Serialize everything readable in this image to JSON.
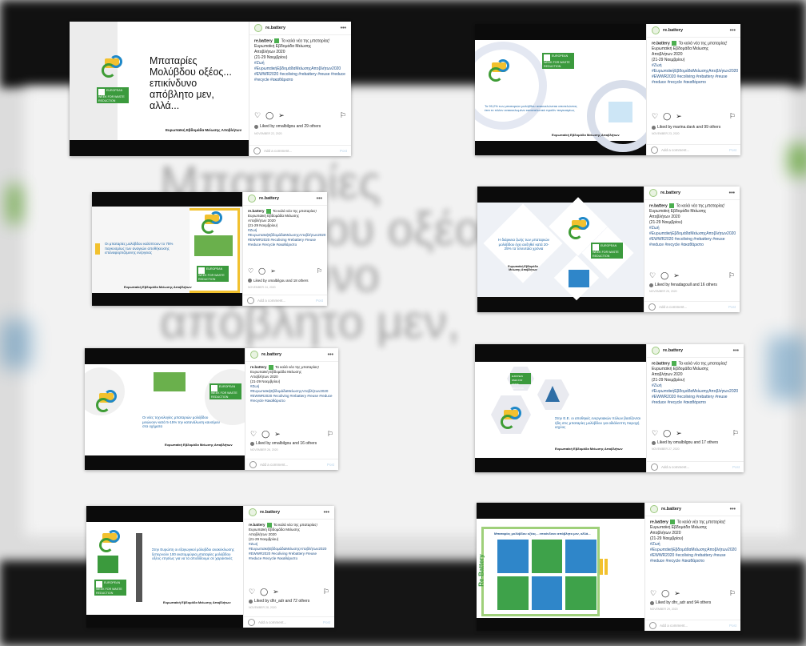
{
  "account": "re.battery",
  "more": "•••",
  "caption": {
    "line1": "Τα καλά νέα της",
    "line2": "μπαταρίας!",
    "line3": "Ευρωπαϊκή Εβδομάδα Μείωσης",
    "line4": "Αποβλήτων 2020",
    "line5": "(21-29 Νοεμβρίου)",
    "tags": "#Ζωή #ΕυρωπαϊκήΕβδομάδαΜείωσηςΑποβλήτων2020 #EWWR2020 #ecoliving #rebattery #reuse #reduce #recycle #ακαθάριστο"
  },
  "comment_placeholder": "Add a comment...",
  "post_button": "Post",
  "footer_text": "Ευρωπαϊκή Εβδομάδα Μείωσης Αποβλήτων",
  "ewwr_label": "EUROPEAN WEEK FOR WASTE REDUCTION",
  "posts": [
    {
      "headline": "Μπαταρίες Μολύβδου οξέος... επικίνδυνο απόβλητο μεν, αλλά...",
      "likes": "Liked by omalbilgou and 29 others",
      "date": "NOVEMBER 22, 2020"
    },
    {
      "headline": "Το 99,2% των μπαταριών μολύβδου ανακυκλώνεται αποτελώντας έτσι το πλέον ανακυκλωμένο καταναλωτικό προϊόν παγκοσμίως",
      "likes": "Liked by marina.davk and 99 others",
      "date": "NOVEMBER 23, 2020"
    },
    {
      "headline": "Οι μπαταρίες μολύβδου καλύπτουν το 75% παγκοσμίως των αναγκών αποθήκευσης επαναφορτιζόμενης ενέργειας",
      "likes": "Liked by omalbilgou and 18 others",
      "date": "NOVEMBER 24, 2020"
    },
    {
      "headline": "Η διάρκεια ζωής των μπαταριών μολύβδου έχει αυξηθεί κατά 20-25% τα τελευταία χρόνια",
      "likes": "Liked by fenadagoull and 16 others",
      "date": "NOVEMBER 25, 2020"
    },
    {
      "headline": "Οι νέες τεχνολογίες μπαταριών μολύβδου μειώνουν κατά 5-15% την κατανάλωση καυσίμου στα οχήματα",
      "likes": "Liked by omalbilgou and 16 others",
      "date": "NOVEMBER 26, 2020"
    },
    {
      "headline": "Στην Ε.Ε. οι αποθηκές ενεργειακών πόλων βασίζονται ήδη στις μπαταρίες μολύβδου για αδιάλειπτη παροχή ισχύος",
      "likes": "Liked by omalbilgou and 17 others",
      "date": "NOVEMBER 27, 2020"
    },
    {
      "headline": "Στην Ευρώπη οι εξαγωγικοί μόλυβδοι ανακύκλωσης ξεπερνούν 100 εκατομμύρια μπαταρίες μολύβδου οξέος ετησίως για να τα αποδίδουμε σε χαρακτικές",
      "likes": "Liked by dhr_adr and 72 others",
      "date": "NOVEMBER 28, 2020"
    },
    {
      "headline": "Μπαταρίες μολύβδου οξέος... επικίνδυνο απόβλητο μεν, αλλά...",
      "brand": "Re-Battery",
      "likes": "Liked by dhr_adr and 94 others",
      "date": "NOVEMBER 29, 2020"
    }
  ],
  "colors": {
    "accent_green": "#3b9a3d",
    "accent_blue": "#1f66a6",
    "accent_yellow": "#f2c12e"
  },
  "icons": [
    "heart-icon",
    "comment-icon",
    "share-icon",
    "bookmark-icon",
    "smiley-icon",
    "recycle-battery-icon"
  ]
}
